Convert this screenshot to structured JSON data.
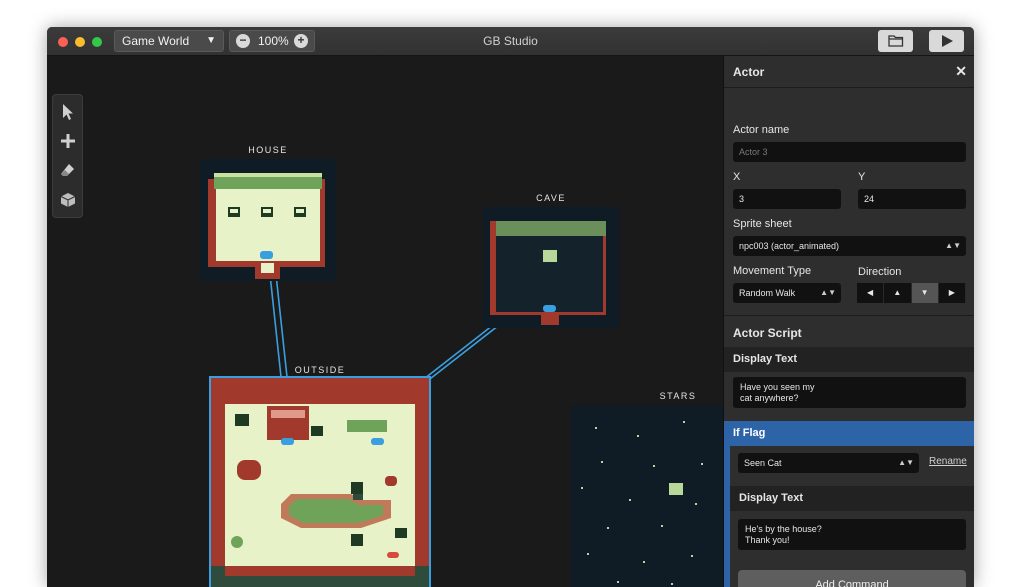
{
  "titlebar": {
    "world_select": "Game World",
    "zoom": "100%",
    "app_title": "GB Studio"
  },
  "tools": [
    {
      "icon": "pointer-icon"
    },
    {
      "icon": "add-icon"
    },
    {
      "icon": "eraser-icon"
    },
    {
      "icon": "cube-icon"
    }
  ],
  "scenes": {
    "house": "HOUSE",
    "cave": "CAVE",
    "outside": "OUTSIDE",
    "stars": "STARS"
  },
  "sidebar": {
    "title": "Actor",
    "actor_name_label": "Actor name",
    "actor_name_placeholder": "Actor 3",
    "x_label": "X",
    "x_value": "3",
    "y_label": "Y",
    "y_value": "24",
    "sprite_label": "Sprite sheet",
    "sprite_value": "npc003 (actor_animated)",
    "movement_label": "Movement Type",
    "movement_value": "Random Walk",
    "direction_label": "Direction",
    "directions": [
      "◀",
      "▲",
      "▼",
      "▶"
    ],
    "script_title": "Actor Script",
    "display_text_1_title": "Display Text",
    "display_text_1_value": "Have you seen my\ncat anywhere?",
    "if_flag_title": "If Flag",
    "flag_value": "Seen Cat",
    "rename_label": "Rename",
    "display_text_2_title": "Display Text",
    "display_text_2_value": "He's by the house?\nThank you!",
    "add_command_label": "Add Command"
  },
  "colors": {
    "selection": "#3a9fe0",
    "brick": "#a13a2c",
    "grass_light": "#e8f2c8",
    "grass_dark": "#6fa35a",
    "night": "#0f1c25",
    "if_flag_accent": "#2d64a8"
  }
}
